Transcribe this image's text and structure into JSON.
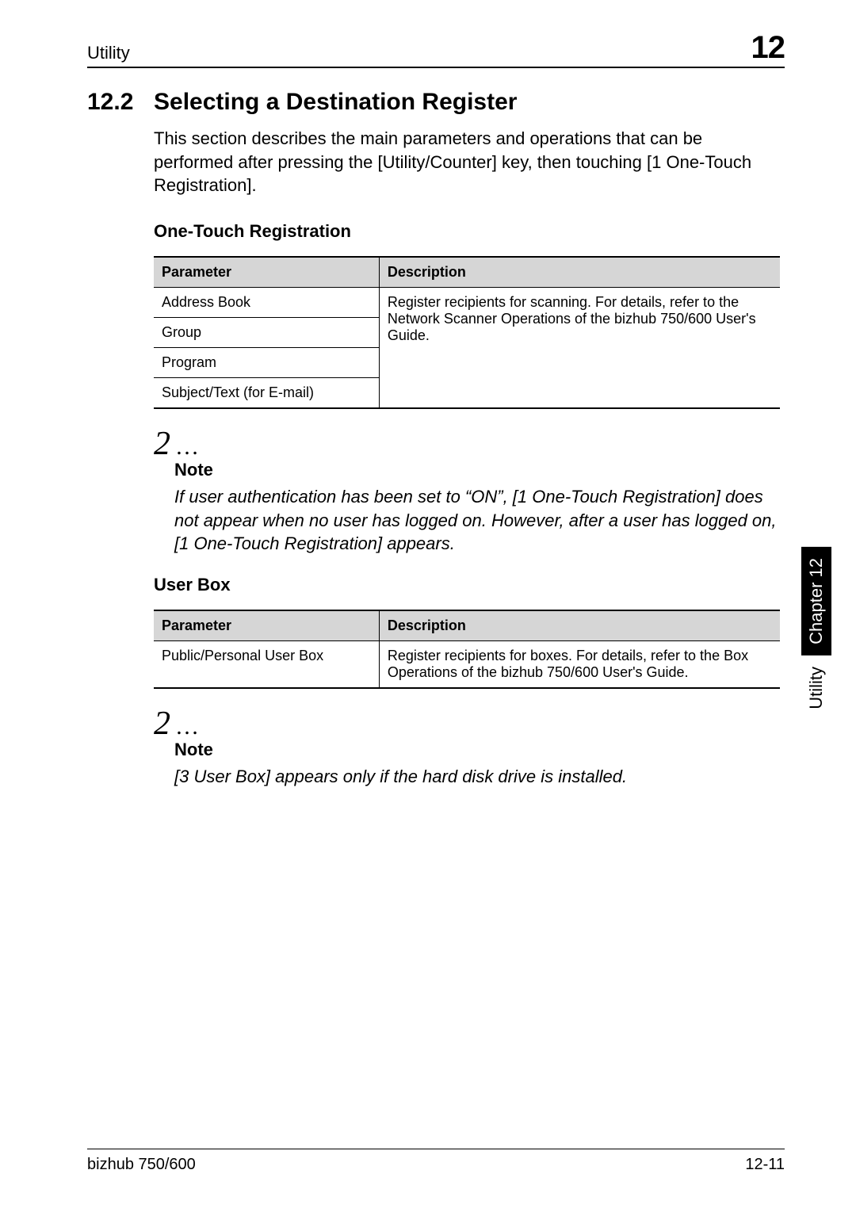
{
  "header": {
    "left": "Utility",
    "right": "12"
  },
  "section": {
    "number": "12.2",
    "title": "Selecting a Destination Register"
  },
  "intro": "This section describes the main parameters and operations that can be performed after pressing the [Utility/Counter] key, then touching [1 One-Touch Registration].",
  "sub1": "One-Touch Registration",
  "table1": {
    "h1": "Parameter",
    "h2": "Description",
    "rows": [
      "Address Book",
      "Group",
      "Program",
      "Subject/Text (for E-mail)"
    ],
    "desc": "Register recipients for scanning. For details, refer to the Network Scanner Operations of the bizhub 750/600 User's Guide."
  },
  "note_symbol": "2",
  "note1": {
    "label": "Note",
    "text": "If user authentication has been set to “ON”, [1 One-Touch Registration] does not appear when no user has logged on. However, after a user has logged on, [1 One-Touch Registration] appears."
  },
  "sub2": "User Box",
  "table2": {
    "h1": "Parameter",
    "h2": "Description",
    "row": "Public/Personal User Box",
    "desc": "Register recipients for boxes. For details, refer to the Box Operations of the bizhub 750/600 User's Guide."
  },
  "note2": {
    "label": "Note",
    "text": "[3 User Box] appears only if the hard disk drive is installed."
  },
  "sidetab": {
    "black": "Chapter 12",
    "white": "Utility"
  },
  "footer": {
    "left": "bizhub 750/600",
    "right": "12-11"
  }
}
